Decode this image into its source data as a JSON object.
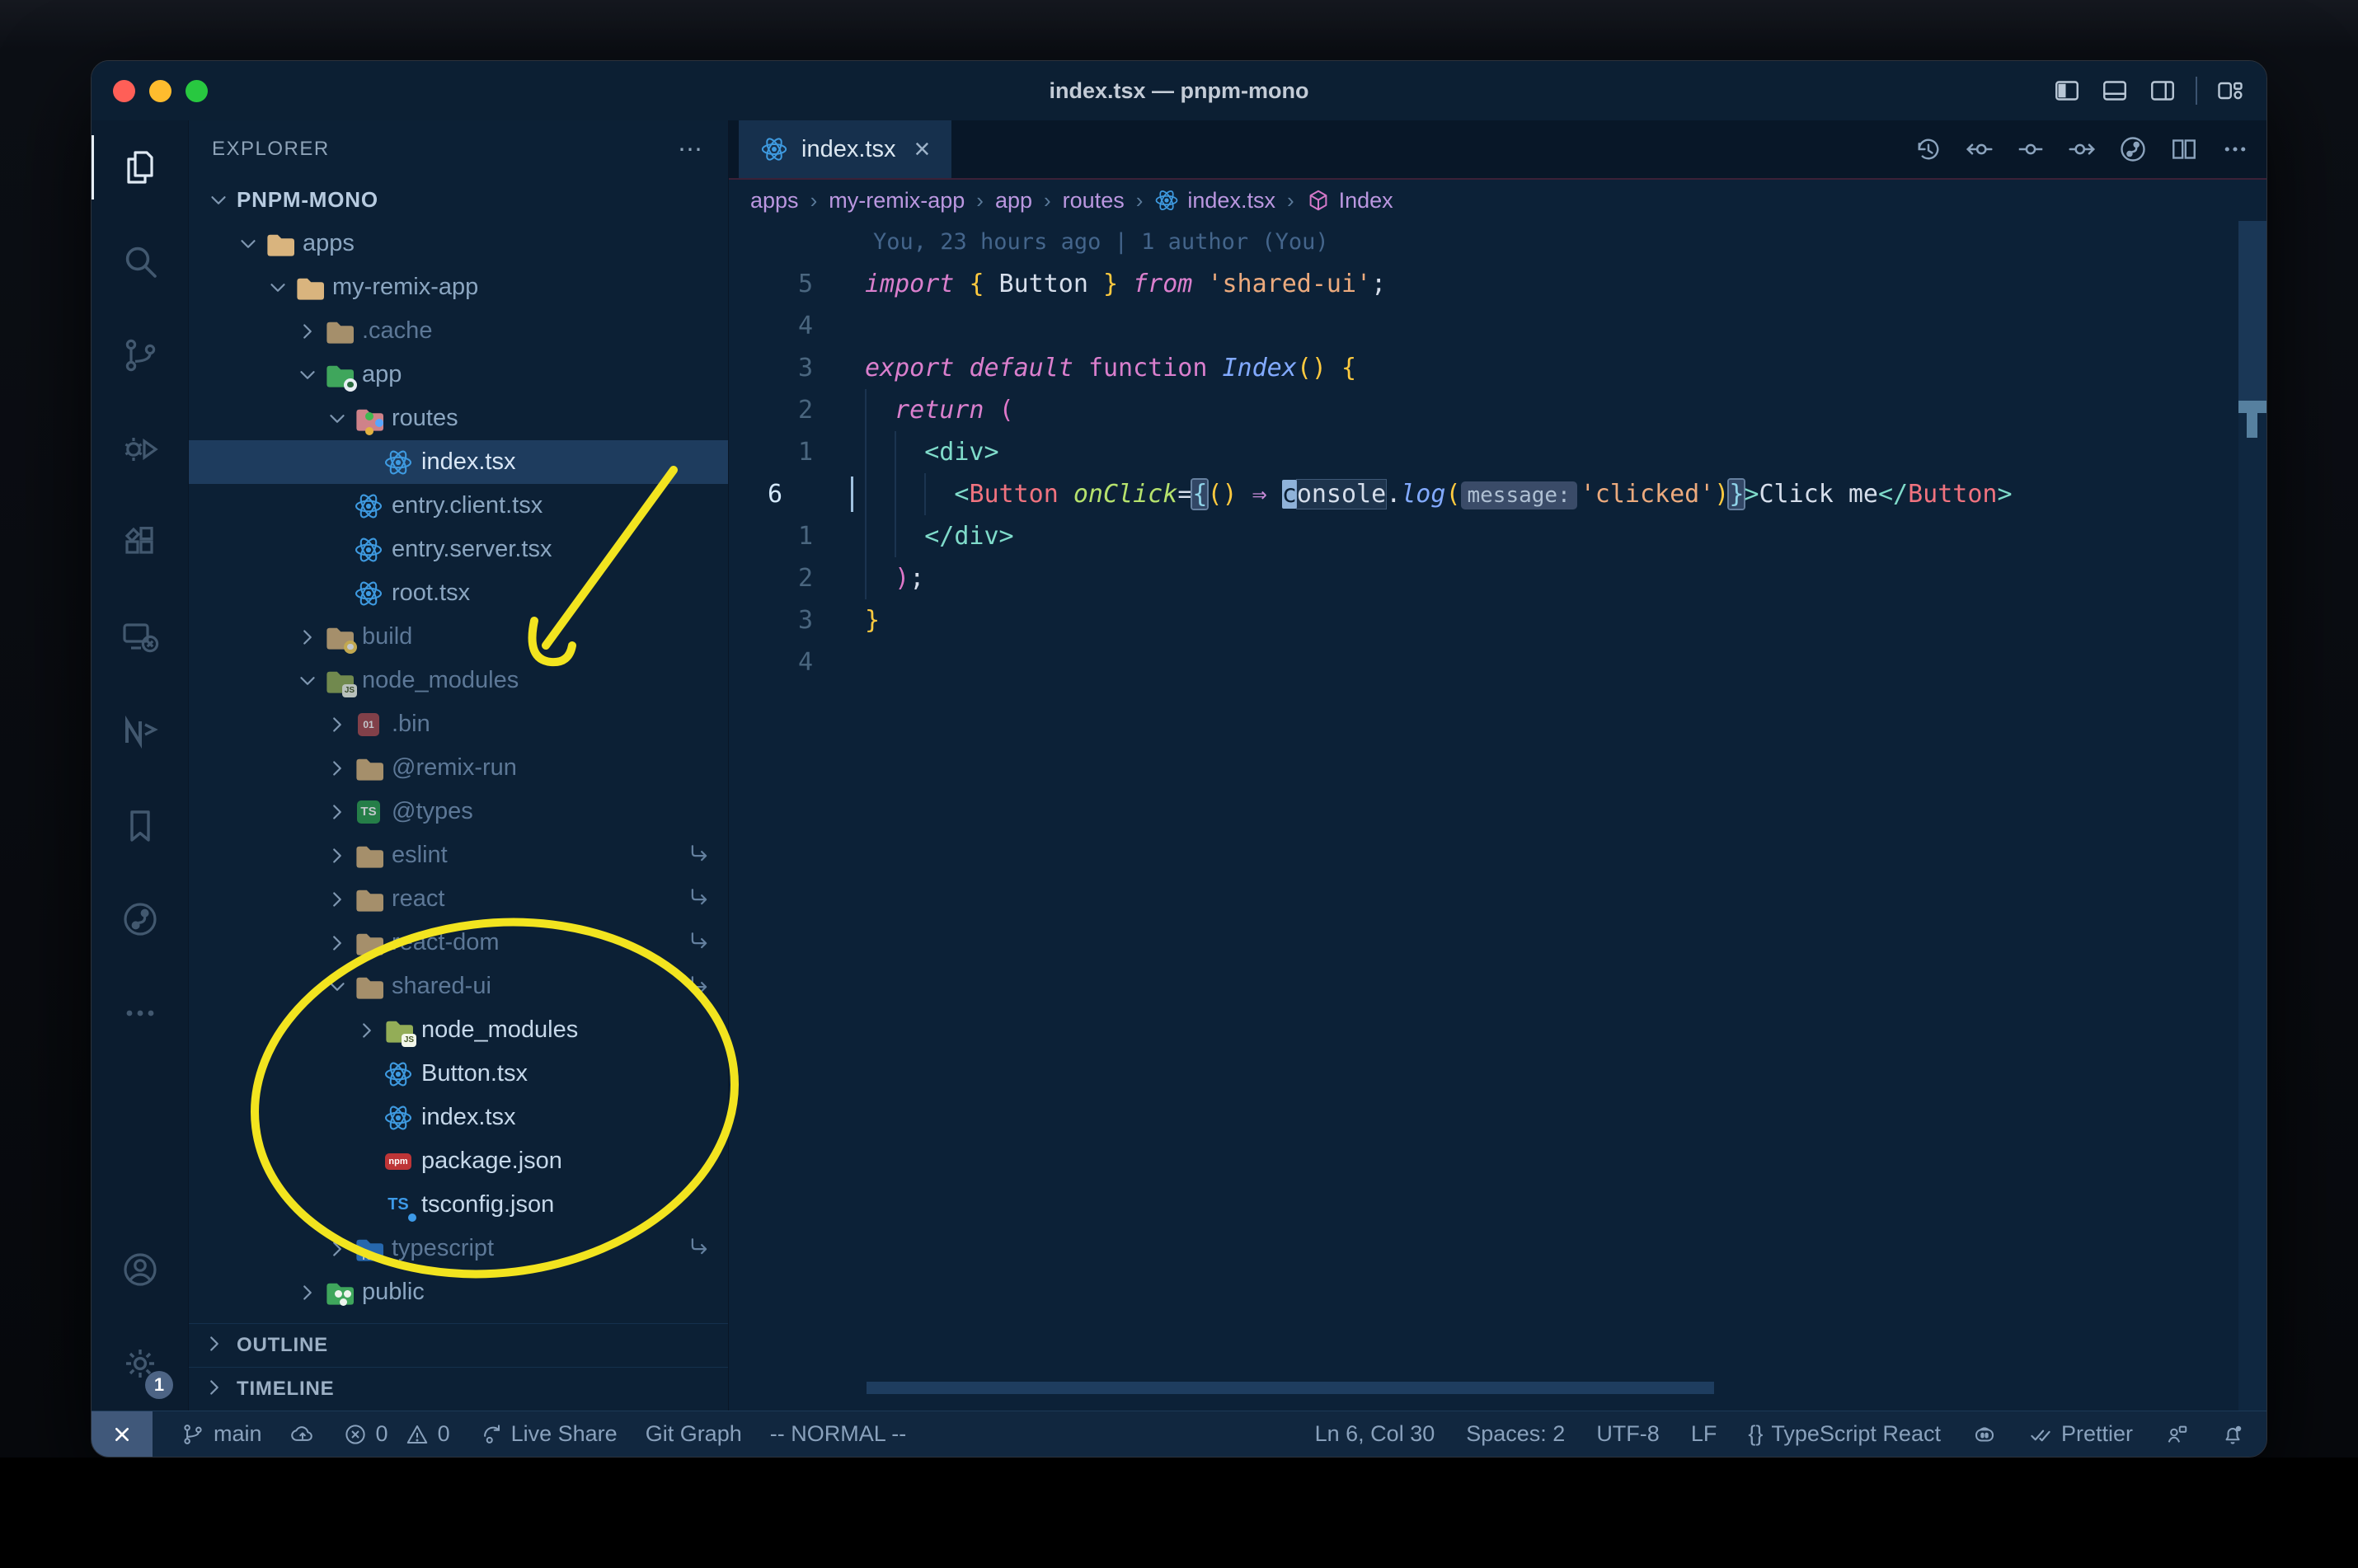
{
  "window": {
    "title": "index.tsx — pnpm-mono"
  },
  "colors": {
    "annotation_yellow": "#f2e41f",
    "selection_row": "#1e3c5e",
    "folder_tan": "#d9b47e",
    "folder_green": "#3fa65c",
    "folder_salmon": "#cf8289",
    "folder_olive": "#93ad57",
    "folder_blue": "#2f7fd6",
    "react_blue": "#3e9ae0",
    "npm_red": "#be3537",
    "keyword_pink": "#da7fcd",
    "string_peach": "#ecaa7d",
    "bracket_gold": "#ffca3f",
    "tag_teal": "#7fdbca",
    "component_red": "#f0737f",
    "function_blue": "#82aaff",
    "attr_green": "#b6e26d",
    "breadcrumb_lavender": "#bb97e0",
    "statusbar_bg": "#11273f",
    "editor_bg": "#0c2137"
  },
  "activity_bar": {
    "items": [
      {
        "name": "explorer",
        "icon": "files-icon",
        "active": true
      },
      {
        "name": "search",
        "icon": "search-icon",
        "active": false
      },
      {
        "name": "source-control",
        "icon": "source-control-icon",
        "active": false
      },
      {
        "name": "run-debug",
        "icon": "debug-icon",
        "active": false
      },
      {
        "name": "extensions",
        "icon": "extensions-icon",
        "active": false
      },
      {
        "name": "remote-explorer",
        "icon": "remote-icon",
        "active": false
      },
      {
        "name": "nx-console",
        "icon": "nx-icon",
        "active": false
      },
      {
        "name": "bookmarks",
        "icon": "bookmark-icon",
        "active": false
      },
      {
        "name": "git-graph",
        "icon": "git-graph-icon",
        "active": false
      },
      {
        "name": "more",
        "icon": "ellipsis-icon",
        "active": false
      }
    ],
    "bottom": [
      {
        "name": "account",
        "icon": "account-icon"
      },
      {
        "name": "settings",
        "icon": "gear-icon",
        "badge": "1"
      }
    ]
  },
  "sidebar": {
    "header": "EXPLORER",
    "header_menu_glyph": "⋯",
    "tree": [
      {
        "label": "PNPM-MONO",
        "indent": 0,
        "chevron": "down",
        "icon": null,
        "root": true
      },
      {
        "label": "apps",
        "indent": 1,
        "chevron": "down",
        "icon": "folder-icon"
      },
      {
        "label": "my-remix-app",
        "indent": 2,
        "chevron": "down",
        "icon": "folder-icon"
      },
      {
        "label": ".cache",
        "indent": 3,
        "chevron": "right",
        "icon": "folder-icon",
        "dim": true
      },
      {
        "label": "app",
        "indent": 3,
        "chevron": "down",
        "icon": "app-folder-icon"
      },
      {
        "label": "routes",
        "indent": 4,
        "chevron": "down",
        "icon": "routes-folder-icon"
      },
      {
        "label": "index.tsx",
        "indent": 5,
        "chevron": "none",
        "icon": "react-file-icon",
        "selected": true
      },
      {
        "label": "entry.client.tsx",
        "indent": 4,
        "chevron": "none",
        "icon": "react-file-icon"
      },
      {
        "label": "entry.server.tsx",
        "indent": 4,
        "chevron": "none",
        "icon": "react-file-icon"
      },
      {
        "label": "root.tsx",
        "indent": 4,
        "chevron": "none",
        "icon": "react-file-icon"
      },
      {
        "label": "build",
        "indent": 3,
        "chevron": "right",
        "icon": "build-folder-icon",
        "dim": true
      },
      {
        "label": "node_modules",
        "indent": 3,
        "chevron": "down",
        "icon": "node-modules-folder-icon",
        "dim": true
      },
      {
        "label": ".bin",
        "indent": 4,
        "chevron": "right",
        "icon": "bin-file-icon",
        "dim": true
      },
      {
        "label": "@remix-run",
        "indent": 4,
        "chevron": "right",
        "icon": "folder-icon",
        "dim": true
      },
      {
        "label": "@types",
        "indent": 4,
        "chevron": "right",
        "icon": "types-folder-icon",
        "dim": true
      },
      {
        "label": "eslint",
        "indent": 4,
        "chevron": "right",
        "icon": "folder-icon",
        "dim": true,
        "symlink": true
      },
      {
        "label": "react",
        "indent": 4,
        "chevron": "right",
        "icon": "folder-icon",
        "dim": true,
        "symlink": true
      },
      {
        "label": "react-dom",
        "indent": 4,
        "chevron": "right",
        "icon": "folder-icon",
        "dim": true,
        "symlink": true
      },
      {
        "label": "shared-ui",
        "indent": 4,
        "chevron": "down",
        "icon": "folder-icon",
        "dim": true,
        "symlink": true
      },
      {
        "label": "node_modules",
        "indent": 5,
        "chevron": "right",
        "icon": "node-modules-folder-icon",
        "bright": true
      },
      {
        "label": "Button.tsx",
        "indent": 5,
        "chevron": "none",
        "icon": "react-file-icon",
        "bright": true
      },
      {
        "label": "index.tsx",
        "indent": 5,
        "chevron": "none",
        "icon": "react-file-icon",
        "bright": true
      },
      {
        "label": "package.json",
        "indent": 5,
        "chevron": "none",
        "icon": "npm-file-icon",
        "bright": true
      },
      {
        "label": "tsconfig.json",
        "indent": 5,
        "chevron": "none",
        "icon": "tsconfig-file-icon",
        "bright": true
      },
      {
        "label": "typescript",
        "indent": 4,
        "chevron": "right",
        "icon": "ts-folder-icon",
        "dim": true,
        "symlink": true
      },
      {
        "label": "public",
        "indent": 3,
        "chevron": "right",
        "icon": "public-folder-icon"
      }
    ],
    "sections": [
      {
        "label": "OUTLINE"
      },
      {
        "label": "TIMELINE"
      }
    ]
  },
  "tabs": [
    {
      "label": "index.tsx",
      "icon": "react-icon",
      "close_glyph": "×",
      "active": true
    }
  ],
  "editor_toolbar": [
    {
      "name": "timeline-history",
      "icon": "history-icon"
    },
    {
      "name": "previous-change",
      "icon": "commit-left-icon"
    },
    {
      "name": "current-commit",
      "icon": "commit-icon"
    },
    {
      "name": "next-change",
      "icon": "commit-right-icon"
    },
    {
      "name": "git-graph-view",
      "icon": "git-graph-icon"
    },
    {
      "name": "split-editor",
      "icon": "split-icon"
    },
    {
      "name": "more-actions",
      "icon": "ellipsis-icon"
    }
  ],
  "window_controls": [
    {
      "name": "toggle-primary-sidebar",
      "icon": "layout-sidebar-left-icon"
    },
    {
      "name": "toggle-panel",
      "icon": "layout-panel-icon"
    },
    {
      "name": "toggle-secondary-sidebar",
      "icon": "layout-sidebar-right-icon"
    },
    {
      "name": "customize-layout",
      "icon": "layout-customize-icon"
    }
  ],
  "breadcrumbs": [
    {
      "label": "apps",
      "icon": null
    },
    {
      "label": "my-remix-app",
      "icon": null
    },
    {
      "label": "app",
      "icon": null
    },
    {
      "label": "routes",
      "icon": null
    },
    {
      "label": "index.tsx",
      "icon": "react-icon"
    },
    {
      "label": "Index",
      "icon": "symbol-module-icon"
    }
  ],
  "breadcrumb_separator": "›",
  "editor": {
    "blame": "You, 23 hours ago | 1 author (You)",
    "lines": [
      {
        "num": "5",
        "guides": 0,
        "tokens": [
          [
            "kw",
            "import"
          ],
          [
            "txt",
            " "
          ],
          [
            "py",
            "{"
          ],
          [
            "txt",
            " Button "
          ],
          [
            "py",
            "}"
          ],
          [
            "txt",
            " "
          ],
          [
            "kw",
            "from"
          ],
          [
            "txt",
            " "
          ],
          [
            "str",
            "'shared-ui'"
          ],
          [
            "txt",
            ";"
          ]
        ]
      },
      {
        "num": "4",
        "guides": 0,
        "tokens": []
      },
      {
        "num": "3",
        "guides": 0,
        "tokens": [
          [
            "kw",
            "export"
          ],
          [
            "txt",
            " "
          ],
          [
            "kw",
            "default"
          ],
          [
            "txt",
            " "
          ],
          [
            "kw2",
            "function"
          ],
          [
            "txt",
            " "
          ],
          [
            "fni",
            "Index"
          ],
          [
            "py",
            "()"
          ],
          [
            "txt",
            " "
          ],
          [
            "py",
            "{"
          ]
        ]
      },
      {
        "num": "2",
        "guides": 1,
        "tokens": [
          [
            "txt",
            "  "
          ],
          [
            "kw",
            "return"
          ],
          [
            "txt",
            " "
          ],
          [
            "pp",
            "("
          ]
        ]
      },
      {
        "num": "1",
        "guides": 2,
        "tokens": [
          [
            "txt",
            "    "
          ],
          [
            "tag",
            "<div>"
          ]
        ]
      },
      {
        "num": "6",
        "current": true,
        "guides": 3,
        "tokens": [
          [
            "txt",
            "      "
          ],
          [
            "tag",
            "<"
          ],
          [
            "cmp",
            "Button"
          ],
          [
            "txt",
            " "
          ],
          [
            "attr",
            "onClick"
          ],
          [
            "op",
            "="
          ],
          [
            "bm",
            "{"
          ],
          [
            "py",
            "()"
          ],
          [
            "txt",
            " "
          ],
          [
            "arrow",
            "⇒"
          ],
          [
            "txt",
            " "
          ],
          [
            "cur",
            "c"
          ],
          [
            "whl",
            "onsole"
          ],
          [
            "txt",
            "."
          ],
          [
            "fni",
            "log"
          ],
          [
            "py",
            "("
          ],
          [
            "inlay",
            "message:"
          ],
          [
            "str",
            "'clicked'"
          ],
          [
            "py",
            ")"
          ],
          [
            "bm",
            "}"
          ],
          [
            "tag",
            ">"
          ],
          [
            "txt",
            "Click me"
          ],
          [
            "tag",
            "</"
          ],
          [
            "cmp",
            "Button"
          ],
          [
            "tag",
            ">"
          ]
        ]
      },
      {
        "num": "1",
        "guides": 2,
        "tokens": [
          [
            "txt",
            "    "
          ],
          [
            "tag",
            "</div>"
          ]
        ]
      },
      {
        "num": "2",
        "guides": 1,
        "tokens": [
          [
            "txt",
            "  "
          ],
          [
            "pp",
            ")"
          ],
          [
            "txt",
            ";"
          ]
        ]
      },
      {
        "num": "3",
        "guides": 0,
        "tokens": [
          [
            "py",
            "}"
          ]
        ]
      },
      {
        "num": "4",
        "guides": 0,
        "tokens": []
      }
    ]
  },
  "status_bar": {
    "remote_indicator": {
      "name": "remote-window",
      "icon": "remote-indicator-icon"
    },
    "left": [
      {
        "name": "git-branch",
        "icon": "branch-icon",
        "label": "main"
      },
      {
        "name": "sync-changes",
        "icon": "cloud-upload-icon",
        "label": ""
      },
      {
        "name": "problems",
        "icon": "error-icon",
        "label": "0",
        "icon2": "warning-icon",
        "label2": "0"
      },
      {
        "name": "live-share",
        "icon": "live-share-icon",
        "label": "Live Share"
      },
      {
        "name": "git-graph",
        "icon": null,
        "label": "Git Graph"
      },
      {
        "name": "vim-mode",
        "icon": null,
        "label": "-- NORMAL --"
      }
    ],
    "right": [
      {
        "name": "cursor-position",
        "icon": null,
        "label": "Ln 6, Col 30"
      },
      {
        "name": "indentation",
        "icon": null,
        "label": "Spaces: 2"
      },
      {
        "name": "encoding",
        "icon": null,
        "label": "UTF-8"
      },
      {
        "name": "eol-sequence",
        "icon": null,
        "label": "LF"
      },
      {
        "name": "language-mode",
        "icon": "braces-icon",
        "label": "TypeScript React",
        "icon_text": "{}"
      },
      {
        "name": "copilot",
        "icon": "copilot-icon",
        "label": ""
      },
      {
        "name": "prettier",
        "icon": "double-check-icon",
        "label": "Prettier"
      },
      {
        "name": "feedback",
        "icon": "person-feedback-icon",
        "label": ""
      },
      {
        "name": "notifications",
        "icon": "bell-icon",
        "label": ""
      }
    ]
  },
  "annotations": {
    "arrow": "hand-drawn yellow arrow pointing to node_modules",
    "circle": "hand-drawn yellow ellipse around shared-ui contents"
  }
}
